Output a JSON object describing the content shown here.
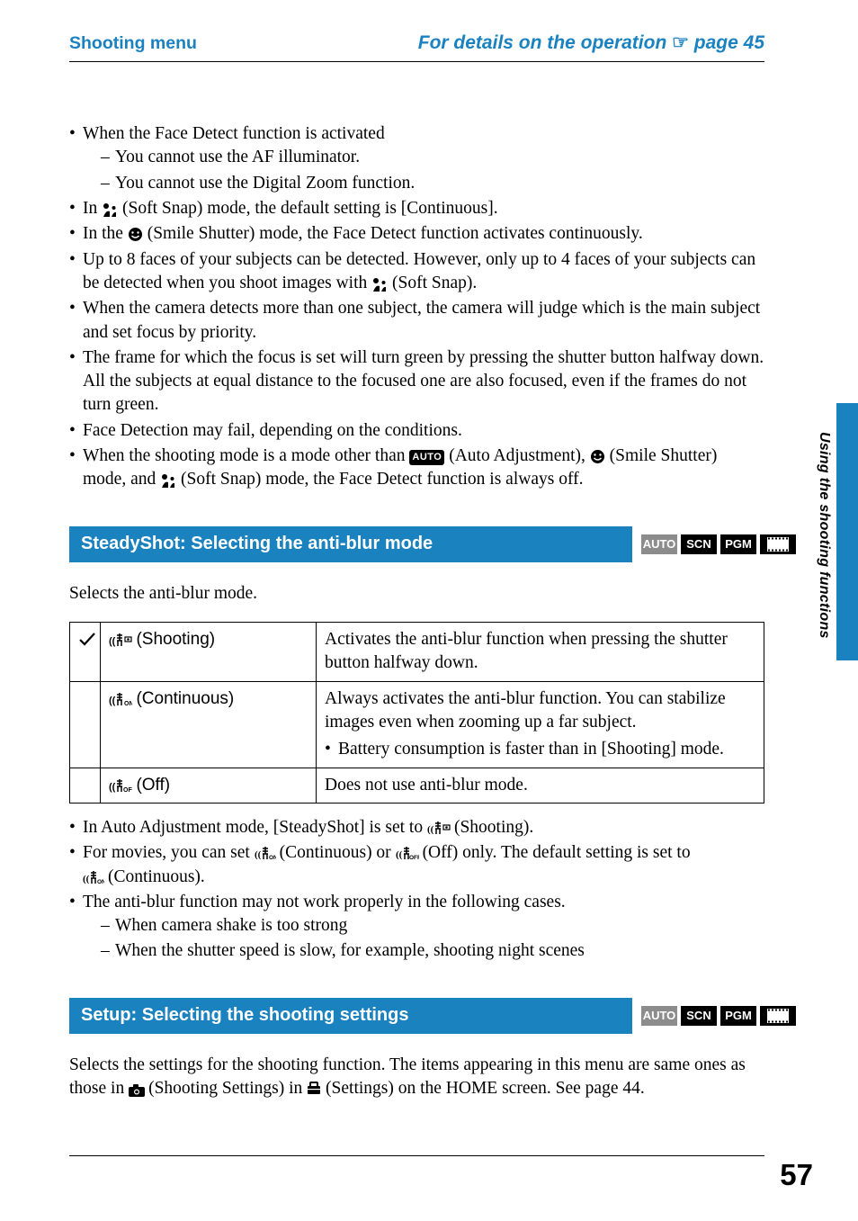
{
  "header": {
    "section": "Shooting menu",
    "op_text_prefix": "For details on the operation ",
    "op_text_page": " page 45"
  },
  "side_label": "Using the shooting functions",
  "page_number": "57",
  "face_detect": {
    "b1": "When the Face Detect function is activated",
    "b1a": "You cannot use the AF illuminator.",
    "b1b": "You cannot use the Digital Zoom function.",
    "b2_pre": "In ",
    "b2_post": " (Soft Snap) mode, the default setting is [Continuous].",
    "b3_pre": "In the ",
    "b3_post": " (Smile Shutter) mode, the Face Detect function activates continuously.",
    "b4_pre": "Up to 8 faces of your subjects can be detected. However, only up to 4 faces of your subjects can be detected when you shoot images with ",
    "b4_post": " (Soft Snap).",
    "b5": "When the camera detects more than one subject, the camera will judge which is the main subject and set focus by priority.",
    "b6": "The frame for which the focus is set will turn green by pressing the shutter button halfway down. All the subjects at equal distance to the focused one are also focused, even if the frames do not turn green.",
    "b7": "Face Detection may fail, depending on the conditions.",
    "b8_pre": "When the shooting mode is a mode other than ",
    "b8_mid1": " (Auto Adjustment), ",
    "b8_mid2": " (Smile Shutter) mode, and ",
    "b8_post": " (Soft Snap) mode, the Face Detect function is always off."
  },
  "steadyshot": {
    "title": "SteadyShot: Selecting the anti-blur mode",
    "intro": "Selects the anti-blur mode.",
    "row1": {
      "name": " (Shooting)",
      "desc": "Activates the anti-blur function when pressing the shutter button halfway down."
    },
    "row2": {
      "name": " (Continuous)",
      "desc": "Always activates the anti-blur function. You can stabilize images even when zooming up a far subject.",
      "note": "Battery consumption is faster than in [Shooting] mode."
    },
    "row3": {
      "name": " (Off)",
      "desc": "Does not use anti-blur mode."
    },
    "n1_pre": "In Auto Adjustment mode, [SteadyShot] is set to ",
    "n1_post": " (Shooting).",
    "n2_pre": "For movies, you can set ",
    "n2_mid": " (Continuous) or ",
    "n2_mid2": " (Off) only. The default setting is set to ",
    "n2_post": " (Continuous).",
    "n3": "The anti-blur function may not work properly in the following cases.",
    "n3a": "When camera shake is too strong",
    "n3b": "When the shutter speed is slow, for example, shooting night scenes"
  },
  "setup": {
    "title": "Setup: Selecting the shooting settings",
    "desc_pre": "Selects the settings for the shooting function. The items appearing in this menu are same ones as those in ",
    "desc_mid": " (Shooting Settings) in ",
    "desc_post": " (Settings) on the HOME screen. See page 44."
  },
  "badges": {
    "auto": "AUTO",
    "scn": "SCN",
    "pgm": "PGM"
  }
}
